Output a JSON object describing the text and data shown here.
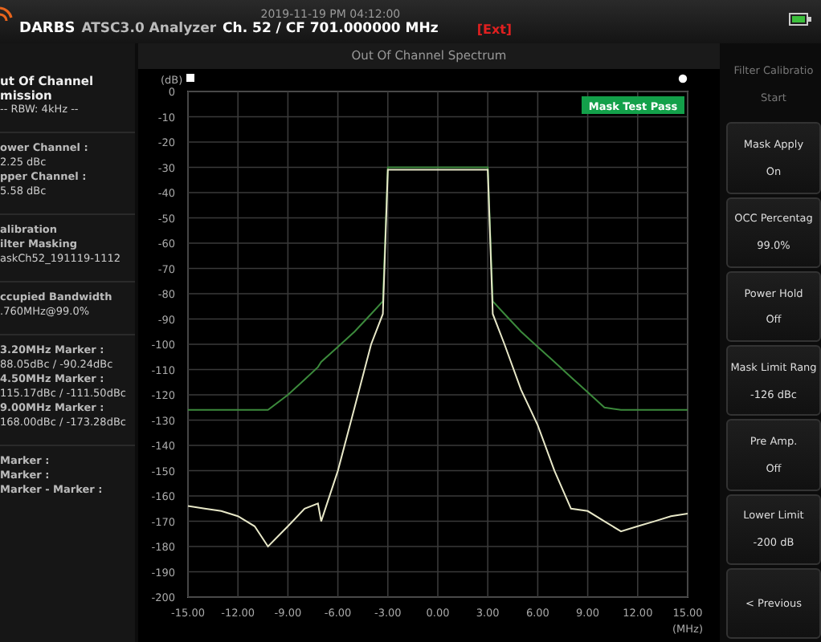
{
  "header": {
    "brand": "DARBS",
    "app": "ATSC3.0 Analyzer",
    "timestamp": "2019-11-19 PM 04:12:00",
    "channel": "Ch. 52 / CF 701.000000 MHz",
    "ref": "[Ext]"
  },
  "left_panel": {
    "title_lines": [
      "ut Of Channel",
      "mission"
    ],
    "rbw": "-- RBW: 4kHz --",
    "sections": [
      [
        {
          "label": "ower Channel :",
          "value": "2.25 dBc"
        },
        {
          "label": "pper Channel :",
          "value": "5.58 dBc"
        }
      ],
      [
        {
          "label": "alibration"
        },
        {
          "label": "ilter Masking",
          "value": "askCh52_191119-1112"
        }
      ],
      [
        {
          "label": "ccupied Bandwidth",
          "value": ".760MHz@99.0%"
        }
      ],
      [
        {
          "label": "3.20MHz Marker :",
          "value": "88.05dBc / -90.24dBc"
        },
        {
          "label": "4.50MHz Marker :",
          "value": "115.17dBc / -111.50dBc"
        },
        {
          "label": "9.00MHz Marker :",
          "value": "168.00dBc / -173.28dBc"
        }
      ],
      [
        {
          "label": "Marker :"
        },
        {
          "label": "Marker :"
        },
        {
          "label": "Marker - Marker :"
        }
      ]
    ]
  },
  "chart_panel": {
    "title": "Out Of Channel Spectrum",
    "badge": "Mask Test Pass",
    "chart_data": {
      "type": "line",
      "xlabel": "(MHz)",
      "ylabel": "(dB)",
      "grid": true,
      "x": [
        -15,
        -14,
        -13,
        -12,
        -11,
        -10.2,
        -9,
        -8,
        -7.2,
        -7,
        -6,
        -5,
        -4,
        -3.3,
        -3,
        -2,
        0,
        2,
        3,
        3.3,
        4,
        5,
        6,
        7,
        8,
        9,
        10,
        11,
        12,
        13,
        14,
        15
      ],
      "series": [
        {
          "color": "#e8e8c8",
          "values": [
            -164,
            -165,
            -166,
            -168,
            -172,
            -180,
            -172,
            -165,
            -163,
            -170,
            -150,
            -125,
            -100,
            -88,
            -31,
            -31,
            -31,
            -31,
            -31,
            -88,
            -100,
            -118,
            -132,
            -150,
            -165,
            -166,
            -170,
            -174,
            -172,
            -170,
            -168,
            -167
          ]
        },
        {
          "color": "#3c8a3c",
          "values": [
            -126,
            -126,
            -126,
            -126,
            -126,
            -126,
            -120,
            -114,
            -109,
            -107,
            -101,
            -95,
            -88,
            -83,
            -30,
            -30,
            -30,
            -30,
            -30,
            -83,
            -88,
            -95,
            -101,
            -107,
            -113,
            -119,
            -125,
            -126,
            -126,
            -126,
            -126,
            -126
          ]
        }
      ],
      "xlim": [
        -15,
        15
      ],
      "ylim": [
        -200,
        0
      ],
      "xticks": [
        {
          "value": -15,
          "label": "-15.00"
        },
        {
          "value": -12,
          "label": "-12.00"
        },
        {
          "value": -9,
          "label": "-9.00"
        },
        {
          "value": -6,
          "label": "-6.00"
        },
        {
          "value": -3,
          "label": "-3.00"
        },
        {
          "value": 0,
          "label": "0.00"
        },
        {
          "value": 3,
          "label": "3.00"
        },
        {
          "value": 6,
          "label": "6.00"
        },
        {
          "value": 9,
          "label": "9.00"
        },
        {
          "value": 12,
          "label": "12.00"
        },
        {
          "value": 15,
          "label": "15.00"
        }
      ],
      "yticks": [
        0,
        -10,
        -20,
        -30,
        -40,
        -50,
        -60,
        -70,
        -80,
        -90,
        -100,
        -110,
        -120,
        -130,
        -140,
        -150,
        -160,
        -170,
        -180,
        -190,
        -200
      ]
    }
  },
  "buttons": [
    {
      "label": "Filter Calibratio",
      "value": "Start",
      "disabled": true
    },
    {
      "label": "Mask Apply",
      "value": "On",
      "disabled": false
    },
    {
      "label": "OCC Percentag",
      "value": "99.0%",
      "disabled": false
    },
    {
      "label": "Power Hold",
      "value": "Off",
      "disabled": false
    },
    {
      "label": "Mask Limit Rang",
      "value": "-126 dBc",
      "disabled": false
    },
    {
      "label": "Pre Amp.",
      "value": "Off",
      "disabled": false
    },
    {
      "label": "Lower Limit",
      "value": "-200 dB",
      "disabled": false
    },
    {
      "label": "< Previous",
      "disabled": false
    }
  ]
}
